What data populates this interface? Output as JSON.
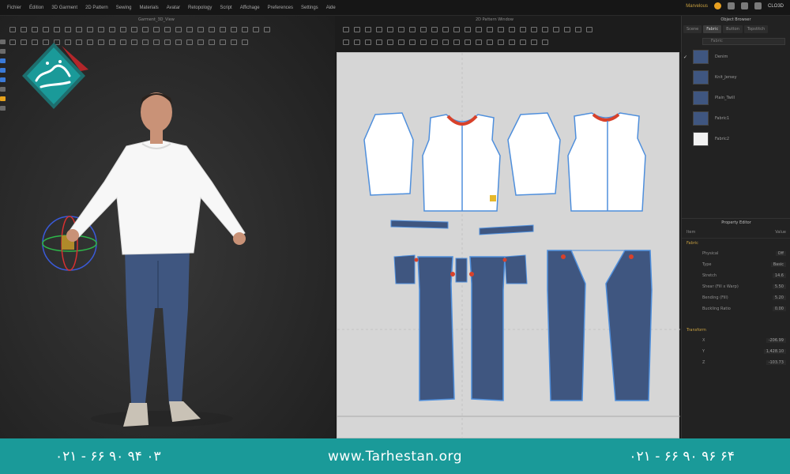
{
  "menubar": {
    "items": [
      "Fichier",
      "Édition",
      "3D Garment",
      "2D Pattern",
      "Sewing",
      "Materials",
      "Avatar",
      "Retopology",
      "Script",
      "Affichage",
      "Preferences",
      "Settings",
      "Aide"
    ],
    "user_label": "Marvelous",
    "user_name": "CLO3D",
    "icons": [
      "cloud-icon",
      "notification-icon",
      "settings-icon",
      "user-icon"
    ]
  },
  "viewport3d": {
    "title": "Garment_3D_View"
  },
  "pattern_window": {
    "title": "2D Pattern Window"
  },
  "right_panel": {
    "header": "Object Browser",
    "tabs": [
      "Scene",
      "Fabric",
      "Button",
      "Topstitch"
    ],
    "active_tab": "Fabric",
    "search_placeholder": "Fabric",
    "fabrics": [
      {
        "name": "Denim",
        "color": "#3f5680",
        "checked": true
      },
      {
        "name": "Knit_Jersey",
        "color": "#3f5680",
        "checked": false
      },
      {
        "name": "Plain_Twill",
        "color": "#3f5680",
        "checked": false
      },
      {
        "name": "Fabric1",
        "color": "#3f5680",
        "checked": false
      },
      {
        "name": "Fabric2",
        "color": "#f2f2f2",
        "checked": false
      }
    ],
    "property_editor": {
      "title": "Property Editor",
      "columns": [
        "Item",
        "Value"
      ],
      "section1": "Fabric",
      "rows": [
        {
          "label": "Physical",
          "value": "Off"
        },
        {
          "label": "Type",
          "value": "Basic"
        },
        {
          "label": "Stretch",
          "value": "14.6"
        },
        {
          "label": "Shear (Fill x Warp)",
          "value": "5.50"
        },
        {
          "label": "Bending (Fill)",
          "value": "5.20"
        },
        {
          "label": "Buckling Ratio",
          "value": "0.00"
        }
      ],
      "section2": "Transform",
      "rows2": [
        {
          "label": "X",
          "value": "-206.99"
        },
        {
          "label": "Y",
          "value": "1,428.10"
        },
        {
          "label": "Z",
          "value": "-103.73"
        }
      ]
    }
  },
  "footer": {
    "phone_left": "۰۲۱ - ۶۶ ۹۰ ۹۴ ۰۳",
    "website": "www.Tarhestan.org",
    "phone_right": "۰۲۱ - ۶۶ ۹۰ ۹۶ ۶۴"
  },
  "logo": {
    "text": "طرحستان"
  },
  "colors": {
    "footer_teal": "#1a9a99",
    "denim": "#3f5680",
    "shirt": "#ffffff",
    "seam_blue": "#4f8fdc",
    "seam_red": "#d8412a"
  }
}
